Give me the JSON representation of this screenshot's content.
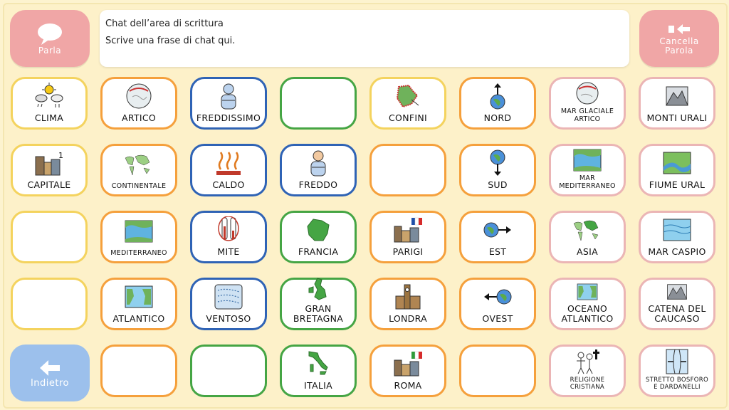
{
  "speak_button": {
    "label": "Parla"
  },
  "clear_button": {
    "label": "Cancella Parola"
  },
  "back_button": {
    "label": "Indietro"
  },
  "chat": {
    "title": "Chat dell’area di scrittura",
    "placeholder": "Scrive una frase di chat qui."
  },
  "grid": {
    "r1": [
      "CLIMA",
      "ARTICO",
      "FREDDISSIMO",
      "",
      "CONFINI",
      "NORD",
      "MAR GLACIALE ARTICO",
      "MONTI URALI"
    ],
    "r2": [
      "CAPITALE",
      "CONTINENTALE",
      "CALDO",
      "FREDDO",
      "",
      "SUD",
      "MAR MEDITERRANEO",
      "FIUME URAL"
    ],
    "r3": [
      "",
      "MEDITERRANEO",
      "MITE",
      "FRANCIA",
      "PARIGI",
      "EST",
      "ASIA",
      "MAR CASPIO"
    ],
    "r4": [
      "",
      "ATLANTICO",
      "VENTOSO",
      "GRAN BRETAGNA",
      "LONDRA",
      "OVEST",
      "OCEANO ATLANTICO",
      "CATENA DEL CAUCASO"
    ],
    "r5": [
      "ITALIA",
      "ROMA",
      "RELIGIONE CRISTIANA",
      "STRETTO BOSFORO E DARDANELLI"
    ]
  },
  "icons": {
    "speak": "speech-bubble-icon",
    "clear": "backspace-icon",
    "back": "arrow-left-icon"
  },
  "colors": {
    "background": "#fdf3cf",
    "speak_button": "#f0a6a6",
    "back_button": "#9cc0ec",
    "border_yellow": "#f4d35e",
    "border_orange": "#f5a03c",
    "border_blue": "#2f63b5",
    "border_green": "#45a544",
    "border_pink": "#ebb5b5"
  }
}
